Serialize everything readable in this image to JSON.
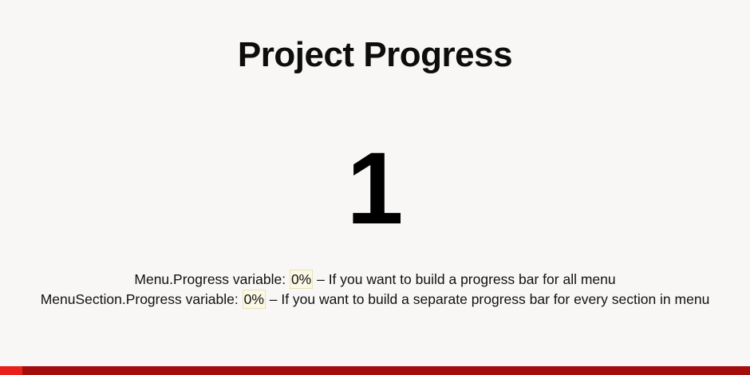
{
  "title": "Project Progress",
  "current_number": "1",
  "lines": [
    {
      "label": "Menu.Progress variable: ",
      "value": "0%",
      "description": " – If you want to build a progress bar for all menu"
    },
    {
      "label": "MenuSection.Progress variable: ",
      "value": "0%",
      "description": " – If you want to build a separate progress bar for every section in menu"
    }
  ],
  "progress_bar": {
    "fraction": 0.03,
    "fill_color": "#e8201a",
    "track_color": "#a50d0d"
  }
}
